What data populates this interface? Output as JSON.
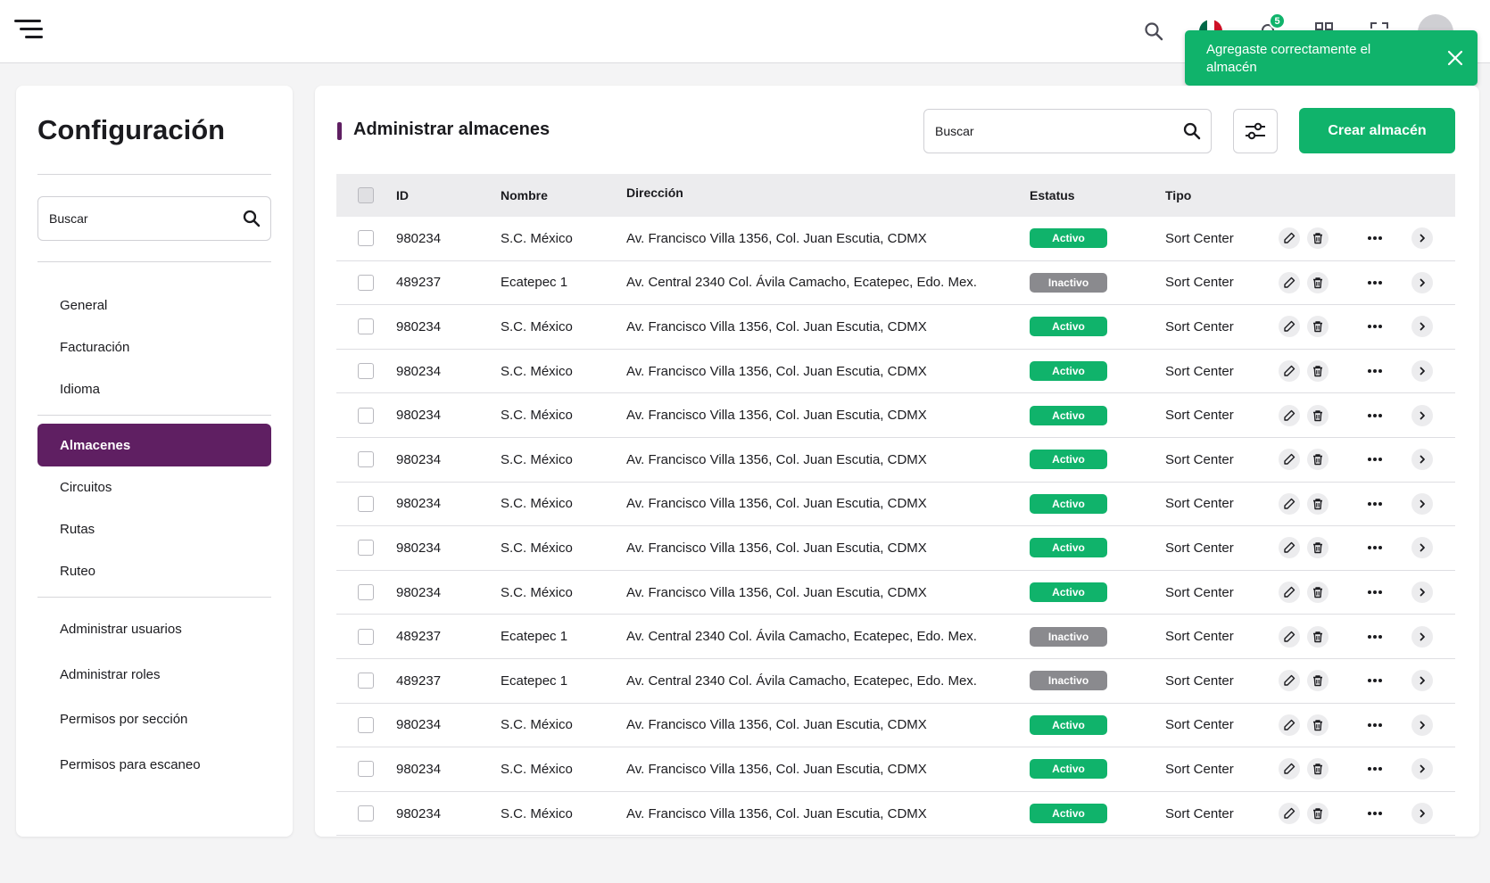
{
  "topbar": {
    "notification_count": "5",
    "flag_colors": [
      "#006847",
      "#ffffff",
      "#ce1126"
    ]
  },
  "toast": {
    "message": "Agregaste correctamente el almacén",
    "color": "#10b36b"
  },
  "sidebar": {
    "title": "Configuración",
    "search_placeholder": "Buscar",
    "groups": [
      [
        "General",
        "Facturación",
        "Idioma"
      ],
      [
        "Almacenes",
        "Circuitos",
        "Rutas",
        "Ruteo"
      ],
      [
        "Administrar usuarios",
        "Administrar roles",
        "Permisos por sección",
        "Permisos para escaneo"
      ]
    ],
    "active_item": "Almacenes",
    "accent_color": "#5f1f62"
  },
  "main": {
    "title": "Administrar almacenes",
    "search_placeholder": "Buscar",
    "create_button": "Crear almacén",
    "table": {
      "columns": [
        "ID",
        "Nombre",
        "Dirección",
        "Estatus",
        "Tipo"
      ],
      "rows": [
        [
          "980234",
          "S.C. México",
          "Av. Francisco Villa 1356, Col. Juan Escutia, CDMX",
          "Activo",
          "Sort Center"
        ],
        [
          "489237",
          "Ecatepec 1",
          "Av. Central 2340 Col. Ávila Camacho, Ecatepec, Edo. Mex.",
          "Inactivo",
          "Sort Center"
        ],
        [
          "980234",
          "S.C. México",
          "Av. Francisco Villa 1356, Col. Juan Escutia, CDMX",
          "Activo",
          "Sort Center"
        ],
        [
          "980234",
          "S.C. México",
          "Av. Francisco Villa 1356, Col. Juan Escutia, CDMX",
          "Activo",
          "Sort Center"
        ],
        [
          "980234",
          "S.C. México",
          "Av. Francisco Villa 1356, Col. Juan Escutia, CDMX",
          "Activo",
          "Sort Center"
        ],
        [
          "980234",
          "S.C. México",
          "Av. Francisco Villa 1356, Col. Juan Escutia, CDMX",
          "Activo",
          "Sort Center"
        ],
        [
          "980234",
          "S.C. México",
          "Av. Francisco Villa 1356, Col. Juan Escutia, CDMX",
          "Activo",
          "Sort Center"
        ],
        [
          "980234",
          "S.C. México",
          "Av. Francisco Villa 1356, Col. Juan Escutia, CDMX",
          "Activo",
          "Sort Center"
        ],
        [
          "980234",
          "S.C. México",
          "Av. Francisco Villa 1356, Col. Juan Escutia, CDMX",
          "Activo",
          "Sort Center"
        ],
        [
          "489237",
          "Ecatepec 1",
          "Av. Central 2340 Col. Ávila Camacho, Ecatepec, Edo. Mex.",
          "Inactivo",
          "Sort Center"
        ],
        [
          "489237",
          "Ecatepec 1",
          "Av. Central 2340 Col. Ávila Camacho, Ecatepec, Edo. Mex.",
          "Inactivo",
          "Sort Center"
        ],
        [
          "980234",
          "S.C. México",
          "Av. Francisco Villa 1356, Col. Juan Escutia, CDMX",
          "Activo",
          "Sort Center"
        ],
        [
          "980234",
          "S.C. México",
          "Av. Francisco Villa 1356, Col. Juan Escutia, CDMX",
          "Activo",
          "Sort Center"
        ],
        [
          "980234",
          "S.C. México",
          "Av. Francisco Villa 1356, Col. Juan Escutia, CDMX",
          "Activo",
          "Sort Center"
        ]
      ],
      "row_icons": [
        "pencil-icon",
        "trash-icon",
        "more-horizontal-icon",
        "chevron-right-icon"
      ]
    },
    "status_colors": {
      "Activo": "#10b36b",
      "Inactivo": "#8a8a8e"
    }
  }
}
